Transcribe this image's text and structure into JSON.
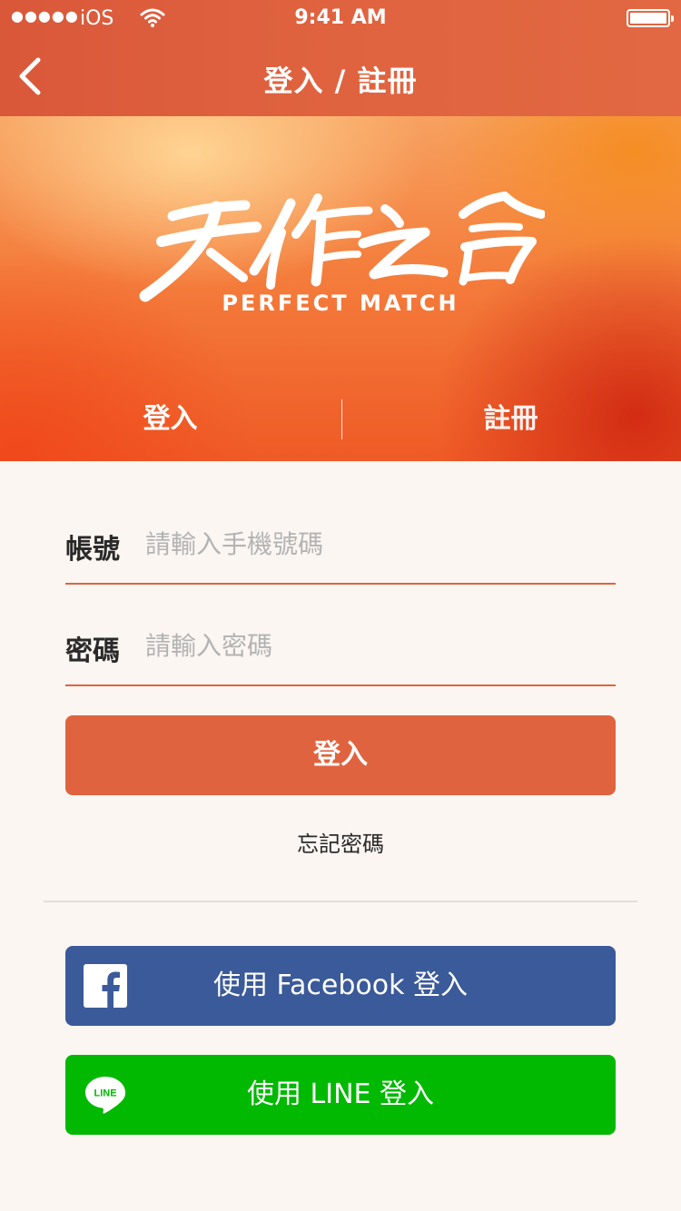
{
  "status_bar": {
    "signal": "●●●●●",
    "carrier": "iOS",
    "time": "9:41 AM"
  },
  "nav": {
    "title": "登入 / 註冊",
    "back_icon": "chevron-left-icon"
  },
  "hero": {
    "logo_subtitle": "PERFECT MATCH",
    "logo_chinese": "天作之合"
  },
  "tabs": {
    "login": "登入",
    "register": "註冊",
    "active": "login"
  },
  "form": {
    "account": {
      "label": "帳號",
      "placeholder": "請輸入手機號碼",
      "value": ""
    },
    "password": {
      "label": "密碼",
      "placeholder": "請輸入密碼",
      "value": ""
    },
    "login_button": "登入",
    "forgot_password": "忘記密碼"
  },
  "social": {
    "facebook_label": "使用 Facebook 登入",
    "facebook_icon": "facebook-icon",
    "line_label": "使用 LINE 登入",
    "line_icon": "line-icon",
    "line_icon_text": "LINE"
  },
  "colors": {
    "accent": "#e0633f",
    "facebook": "#3b5a9a",
    "line": "#00b900",
    "background": "#fbf6f2"
  }
}
